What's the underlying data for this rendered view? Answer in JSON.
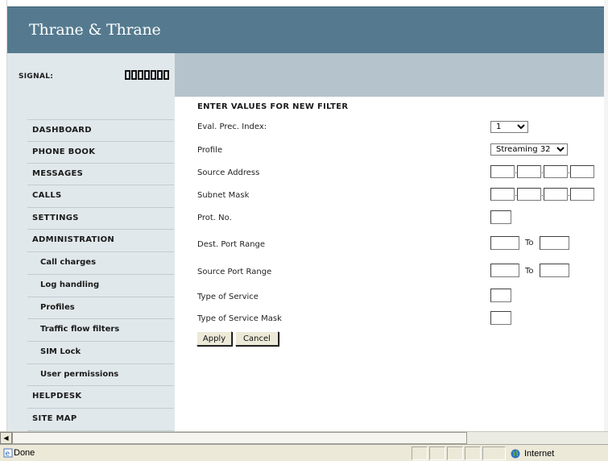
{
  "header": {
    "logo": "Thrane & Thrane",
    "signal_label": "SIGNAL:",
    "signal_bars": 7
  },
  "sidebar": {
    "items": [
      {
        "label": "DASHBOARD",
        "sub": false
      },
      {
        "label": "PHONE BOOK",
        "sub": false
      },
      {
        "label": "MESSAGES",
        "sub": false
      },
      {
        "label": "CALLS",
        "sub": false
      },
      {
        "label": "SETTINGS",
        "sub": false
      },
      {
        "label": "ADMINISTRATION",
        "sub": false
      },
      {
        "label": "Call charges",
        "sub": true
      },
      {
        "label": "Log handling",
        "sub": true
      },
      {
        "label": "Profiles",
        "sub": true
      },
      {
        "label": "Traffic flow filters",
        "sub": true
      },
      {
        "label": "SIM Lock",
        "sub": true
      },
      {
        "label": "User permissions",
        "sub": true
      },
      {
        "label": "HELPDESK",
        "sub": false
      },
      {
        "label": "SITE MAP",
        "sub": false
      }
    ]
  },
  "form": {
    "title": "ENTER VALUES FOR NEW FILTER",
    "fields": {
      "eval_index": {
        "label": "Eval. Prec. Index:",
        "value": "1"
      },
      "profile": {
        "label": "Profile",
        "value": "Streaming 32"
      },
      "source_address": {
        "label": "Source Address"
      },
      "subnet_mask": {
        "label": "Subnet Mask"
      },
      "prot_no": {
        "label": "Prot. No."
      },
      "dest_port_range": {
        "label": "Dest. Port Range",
        "to_label": "To"
      },
      "source_port_range": {
        "label": "Source Port Range",
        "to_label": "To"
      },
      "tos": {
        "label": "Type of Service"
      },
      "tos_mask": {
        "label": "Type of Service Mask"
      }
    },
    "buttons": {
      "apply": "Apply",
      "cancel": "Cancel"
    }
  },
  "statusbar": {
    "text": "Done",
    "zone": "Internet"
  },
  "colors": {
    "banner": "#557a8f",
    "signal_bar": "#b5c4cc",
    "sidebar": "#e1e8eb"
  }
}
